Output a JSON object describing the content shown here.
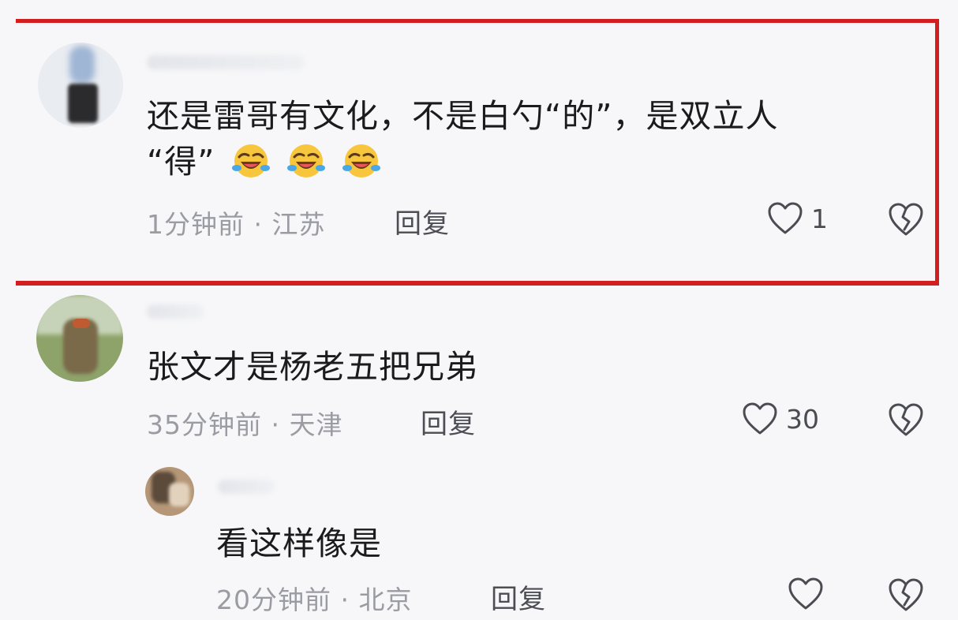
{
  "comments": [
    {
      "text_line1": "还是雷哥有文化，不是白勺“的”，是双立人",
      "text_line2": "“得”",
      "emoji": "laughing-tears-emoji",
      "time_location": "1分钟前 · 江苏",
      "reply_label": "回复",
      "like_count": "1"
    },
    {
      "text": "张文才是杨老五把兄弟",
      "time_location": "35分钟前 · 天津",
      "reply_label": "回复",
      "like_count": "30"
    },
    {
      "text": "看这样像是",
      "time_location": "20分钟前 · 北京",
      "reply_label": "回复",
      "like_count": ""
    }
  ],
  "colors": {
    "highlight": "#d21e1e",
    "background": "#f7f7f9",
    "meta_text": "#9b9ca3"
  },
  "icons": [
    "heart-icon",
    "broken-heart-icon"
  ]
}
